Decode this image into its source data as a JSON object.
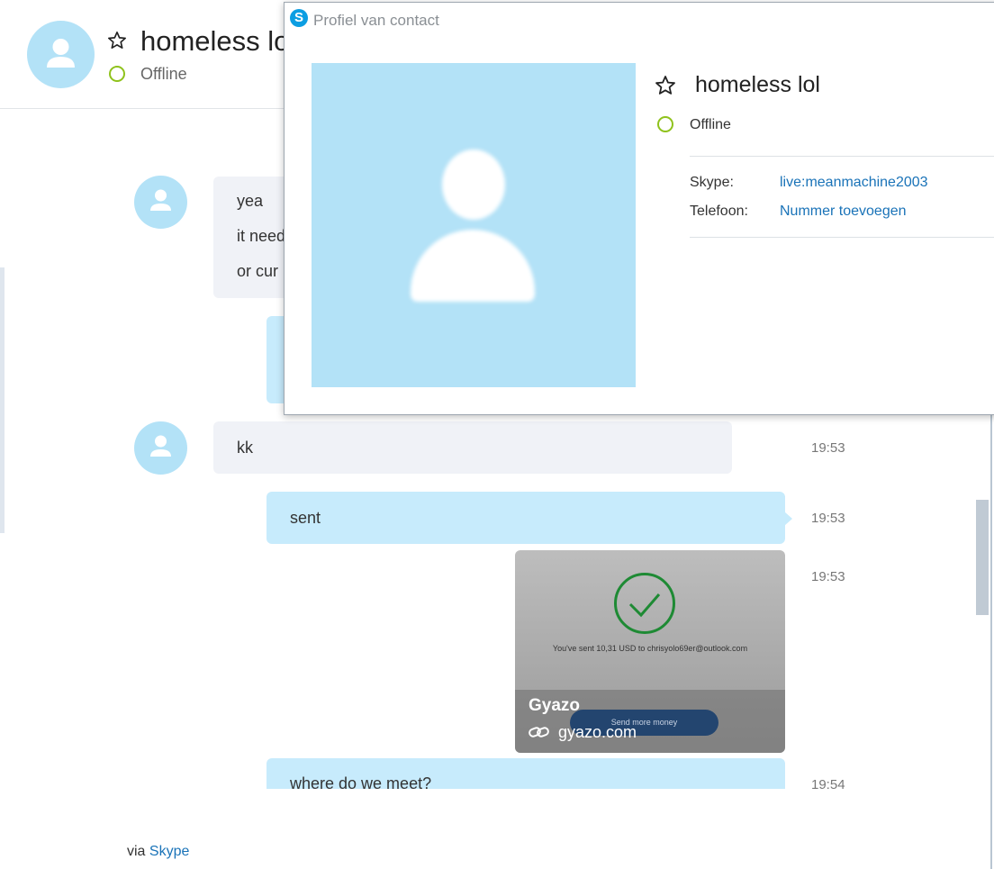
{
  "header": {
    "name": "homeless lol",
    "status": "Offline"
  },
  "messages": [
    {
      "type": "received",
      "lines": [
        "yea",
        "it need",
        "or cur"
      ]
    },
    {
      "type": "received",
      "lines": [
        "kk"
      ],
      "time": "19:53"
    },
    {
      "type": "sent",
      "lines": [
        "sent"
      ],
      "time": "19:53"
    },
    {
      "type": "image",
      "time": "19:53"
    },
    {
      "type": "sent",
      "lines": [
        "where do we meet?"
      ],
      "time": "19:54"
    }
  ],
  "image_card": {
    "sent_text": "You've sent 10,31 USD to chrisyolo69er@outlook.com",
    "button_text": "Send more money",
    "source_title": "Gyazo",
    "source_url": "gyazo.com"
  },
  "popup": {
    "title": "Profiel van contact",
    "name": "homeless lol",
    "status": "Offline",
    "skype_label": "Skype:",
    "skype_value": "live:meanmachine2003",
    "phone_label": "Telefoon:",
    "phone_value": "Nummer toevoegen"
  },
  "footer": {
    "via": "via",
    "link": "Skype"
  },
  "colors": {
    "avatar_bg": "#b3e2f7",
    "status_offline": "#8fc21c",
    "link": "#1a73b8",
    "sent_bubble": "#c7ebfc",
    "received_bubble": "#f0f2f7"
  }
}
